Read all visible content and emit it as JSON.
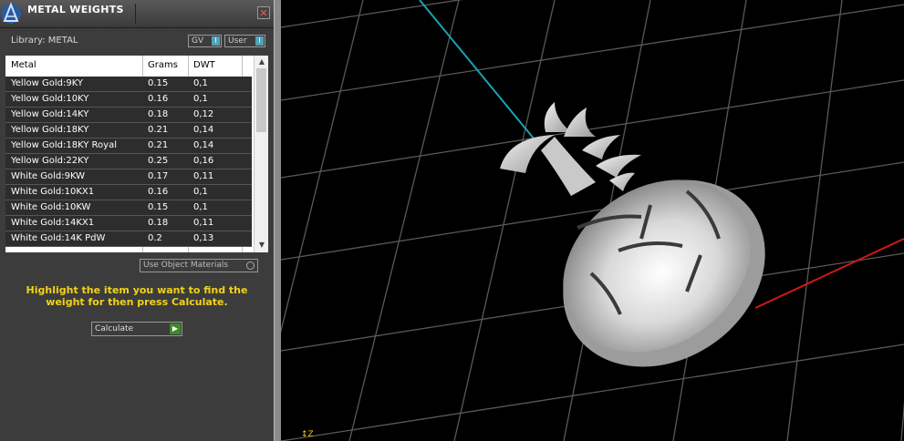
{
  "panel": {
    "title": "METAL WEIGHTS",
    "close_glyph": "✕",
    "library_label": "Library: METAL",
    "toggles": [
      {
        "label": "GV",
        "knob": "I"
      },
      {
        "label": "User",
        "knob": "I"
      }
    ],
    "columns": [
      "Metal",
      "Grams",
      "DWT"
    ],
    "rows": [
      {
        "metal": "Yellow Gold:9KY",
        "grams": "0.15",
        "dwt": "0,1"
      },
      {
        "metal": "Yellow Gold:10KY",
        "grams": "0.16",
        "dwt": "0,1"
      },
      {
        "metal": "Yellow Gold:14KY",
        "grams": "0.18",
        "dwt": "0,12"
      },
      {
        "metal": "Yellow Gold:18KY",
        "grams": "0.21",
        "dwt": "0,14"
      },
      {
        "metal": "Yellow Gold:18KY Royal",
        "grams": "0.21",
        "dwt": "0,14"
      },
      {
        "metal": "Yellow Gold:22KY",
        "grams": "0.25",
        "dwt": "0,16"
      },
      {
        "metal": "White Gold:9KW",
        "grams": "0.17",
        "dwt": "0,11"
      },
      {
        "metal": "White Gold:10KX1",
        "grams": "0.16",
        "dwt": "0,1"
      },
      {
        "metal": "White Gold:10KW",
        "grams": "0.15",
        "dwt": "0,1"
      },
      {
        "metal": "White Gold:14KX1",
        "grams": "0.18",
        "dwt": "0,11"
      },
      {
        "metal": "White Gold:14K PdW",
        "grams": "0.2",
        "dwt": "0,13"
      }
    ],
    "use_object_materials": "Use Object Materials",
    "hint": "Highlight the item you want to find the weight for then press Calculate.",
    "calculate_label": "Calculate",
    "calculate_icon": "play-arrow-icon"
  },
  "viewport": {
    "axis_label": "Z",
    "colors": {
      "grid": "#595959",
      "axis_z": "#1aa3b3",
      "axis_x": "#d01818",
      "model": "#e6e6e6"
    }
  }
}
